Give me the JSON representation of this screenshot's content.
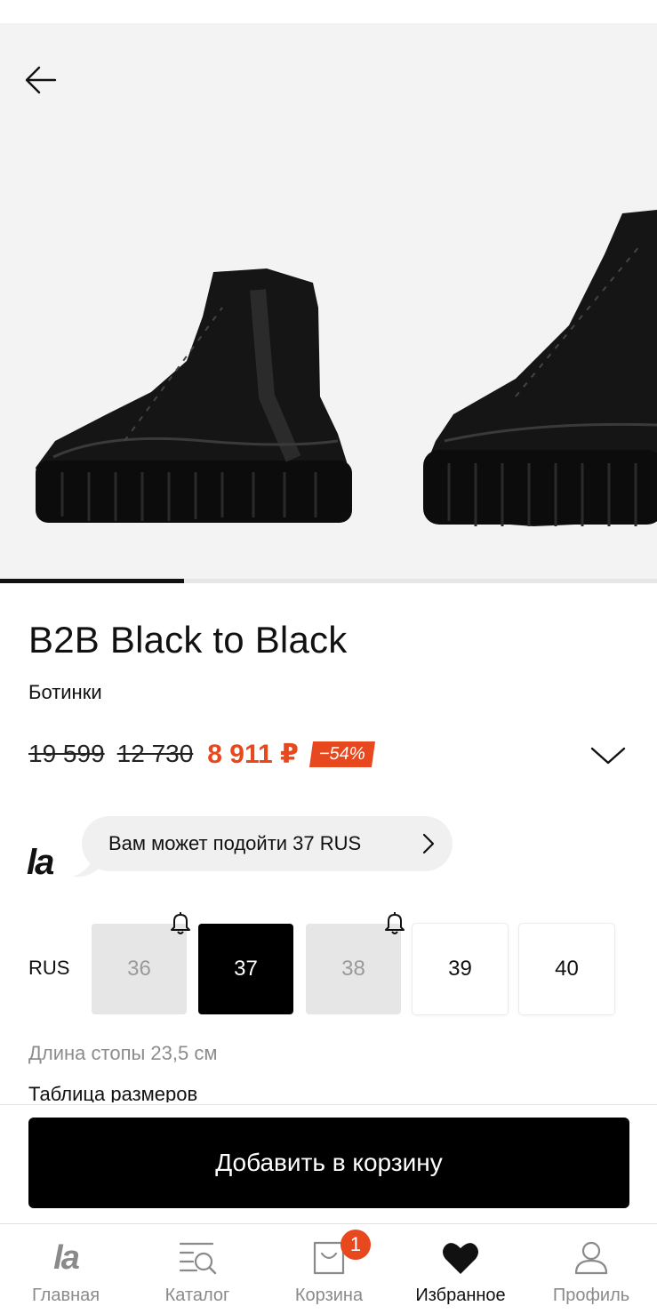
{
  "gallery": {
    "image_alt": "",
    "progress": 0.28
  },
  "nav": {
    "back_icon": "arrow-left-icon"
  },
  "product": {
    "brand": "B2B Black to Black",
    "category": "Ботинки",
    "old_price_1": "19 599",
    "old_price_2": "12 730",
    "price": "8 911 ₽",
    "discount": "−54%"
  },
  "fit_hint": {
    "logo": "la",
    "text": "Вам может подойти 37 RUS"
  },
  "sizes": {
    "system": "RUS",
    "items": [
      {
        "label": "36",
        "state": "unavailable",
        "notify": true
      },
      {
        "label": "37",
        "state": "selected",
        "notify": false
      },
      {
        "label": "38",
        "state": "unavailable",
        "notify": true
      },
      {
        "label": "39",
        "state": "available",
        "notify": false
      },
      {
        "label": "40",
        "state": "available",
        "notify": false
      }
    ],
    "foot_length": "Длина стопы 23,5 см",
    "size_table_link": "Таблица размеров"
  },
  "cta": {
    "add_to_cart": "Добавить в корзину"
  },
  "tabbar": {
    "items": [
      {
        "label": "Главная",
        "icon": "la-logo-icon"
      },
      {
        "label": "Каталог",
        "icon": "catalog-search-icon"
      },
      {
        "label": "Корзина",
        "icon": "shopping-bag-icon"
      },
      {
        "label": "Избранное",
        "icon": "heart-icon"
      },
      {
        "label": "Профиль",
        "icon": "user-icon"
      }
    ],
    "active": "Избранное",
    "cart_badge": "1"
  },
  "colors": {
    "accent": "#e8481e",
    "text": "#111111",
    "muted": "#8c8c8c",
    "unavailable_bg": "#e6e6e6"
  }
}
